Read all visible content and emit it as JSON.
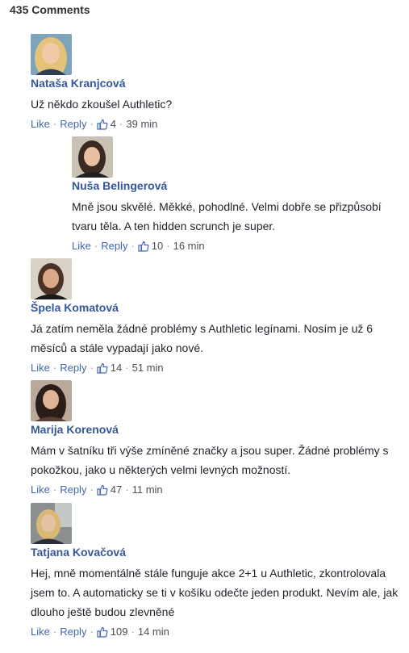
{
  "header": {
    "comment_count": "435 Comments"
  },
  "actions": {
    "like": "Like",
    "reply": "Reply",
    "dot": "·"
  },
  "comments": [
    {
      "author": "Nataša Kranjcová",
      "text": "Už někdo zkoušel Authletic?",
      "likes": "4",
      "time": "39 min",
      "avatar": "woman-blonde-icon"
    },
    {
      "author": "Nuša Belingerová",
      "text": "Mně jsou skvělé. Měkké, pohodlné. Velmi dobře se přizpůsobí tvaru těla. A ten hidden scrunch je super.",
      "likes": "10",
      "time": "16 min",
      "avatar": "woman-dark-hair-icon"
    },
    {
      "author": "Špela Komatová",
      "text": "Já zatím neměla žádné problémy s Authletic legínami. Nosím je už 6 měsíců a stále vypadají jako nové.",
      "likes": "14",
      "time": "51 min",
      "avatar": "woman-brown-hair-icon"
    },
    {
      "author": "Marija Korenová",
      "text": "Mám v šatníku tři výše zmíněné značky a jsou super. Žádné problémy s pokožkou, jako u některých velmi levných možností.",
      "likes": "47",
      "time": "11 min",
      "avatar": "woman-long-dark-hair-icon"
    },
    {
      "author": "Tatjana Kovačová",
      "text": "Hej, mně momentálně stále funguje akce 2+1 u Authletic, zkontrolovala jsem to. A automaticky se ti v košíku odečte jeden produkt. Nevím ale, jak dlouho ještě budou zlevněné",
      "likes": "109",
      "time": "14 min",
      "avatar": "woman-blonde-office-icon"
    }
  ]
}
